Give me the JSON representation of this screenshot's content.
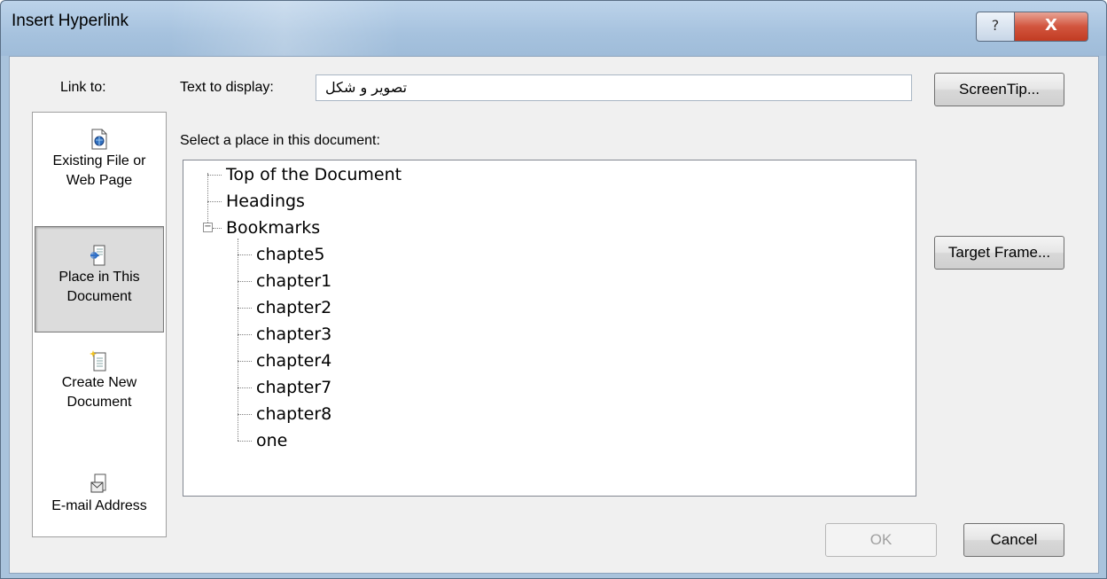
{
  "window": {
    "title": "Insert Hyperlink",
    "help_glyph": "?",
    "close_glyph": "X"
  },
  "link_to": {
    "label": "Link to:",
    "items": [
      {
        "line1": "Existing File or",
        "line2": "Web Page",
        "icon": "web-page-icon",
        "selected": false
      },
      {
        "line1": "Place in This",
        "line2": "Document",
        "icon": "place-in-document-icon",
        "selected": true
      },
      {
        "line1": "Create New",
        "line2": "Document",
        "icon": "new-document-icon",
        "selected": false
      },
      {
        "line1": "E-mail Address",
        "line2": "",
        "icon": "email-icon",
        "selected": false
      }
    ]
  },
  "text_to_display": {
    "label": "Text to display:",
    "value": "تصویر و شکل"
  },
  "place": {
    "label": "Select a place in this document:",
    "tree": {
      "top": "Top of the Document",
      "headings": "Headings",
      "bookmarks": "Bookmarks",
      "bookmark_items": [
        "chapte5",
        "chapter1",
        "chapter2",
        "chapter3",
        "chapter4",
        "chapter7",
        "chapter8",
        "one"
      ]
    }
  },
  "buttons": {
    "screentip": "ScreenTip...",
    "target_frame": "Target Frame...",
    "ok": "OK",
    "cancel": "Cancel"
  },
  "colors": {
    "title_bar": "#a6c2de",
    "close_button": "#c23b22",
    "client_bg": "#f0f0f0"
  }
}
